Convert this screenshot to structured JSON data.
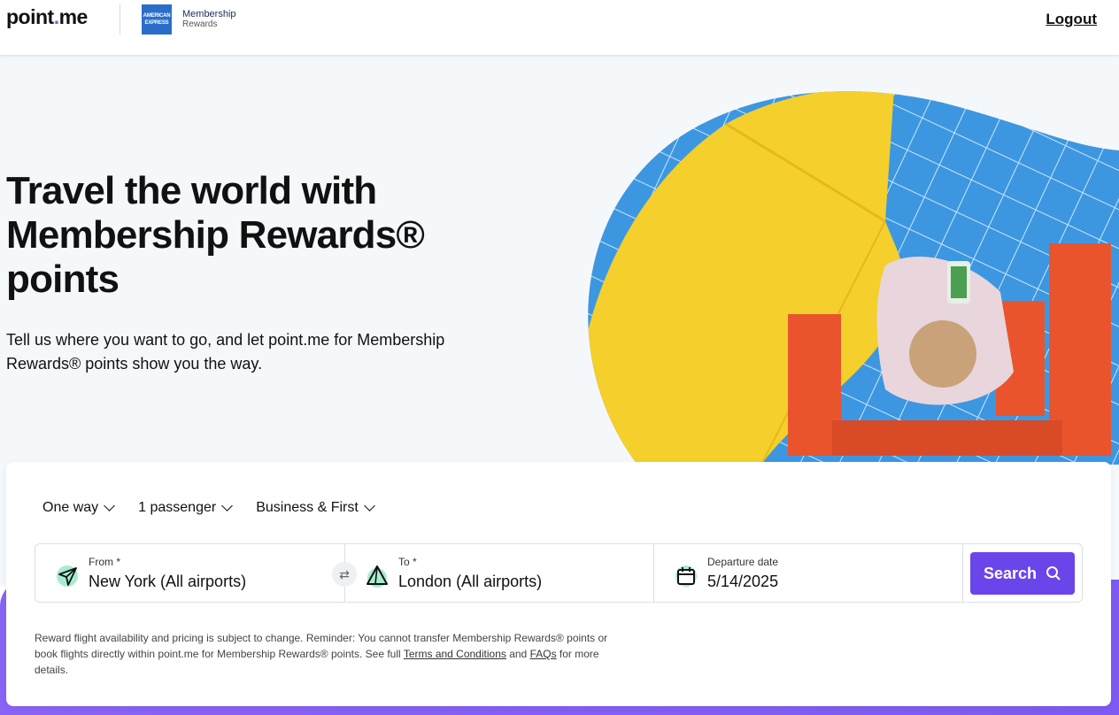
{
  "header": {
    "brand_text": "point",
    "brand_dot": ".",
    "brand_tail": "me",
    "amex_line1": "AMERICAN",
    "amex_line2": "EXPRESS",
    "mr_line1": "Membership",
    "mr_line2": "Rewards",
    "logout_label": "Logout"
  },
  "hero": {
    "headline": "Travel the world with Membership Rewards® points",
    "subline": "Tell us where you want to go, and let point.me for Membership Rewards® points show you the way."
  },
  "search": {
    "trip_type": "One way",
    "passengers": "1 passenger",
    "cabin": "Business & First",
    "from_label": "From *",
    "from_value": "New York (All airports)",
    "to_label": "To *",
    "to_value": "London (All airports)",
    "date_label": "Departure date",
    "date_value": "5/14/2025",
    "search_label": "Search"
  },
  "disclaimer": {
    "text_before": "Reward flight availability and pricing is subject to change. Reminder: You cannot transfer Membership Rewards® points or book flights directly within point.me for Membership Rewards® points. See full ",
    "terms_link": "Terms and Conditions",
    "and_text": " and ",
    "faq_link": "FAQs",
    "text_after": " for more details."
  },
  "colors": {
    "accent": "#6a45ea",
    "purple_band": "#8a63f6",
    "amex_blue": "#2a6ec9",
    "from_icon_bg": "#a8ecd0"
  },
  "icons": [
    "chevron-down-icon",
    "send-plane-icon",
    "swap-arrows-icon",
    "triangle-arrival-icon",
    "calendar-icon",
    "search-icon"
  ]
}
